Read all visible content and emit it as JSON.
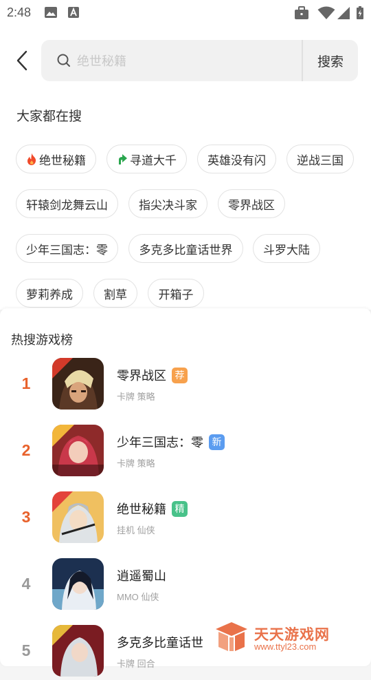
{
  "status_bar": {
    "time": "2:48"
  },
  "search": {
    "placeholder": "绝世秘籍",
    "button_label": "搜索"
  },
  "hot_search": {
    "title": "大家都在搜",
    "tags": [
      {
        "label": "绝世秘籍",
        "icon": "fire-icon"
      },
      {
        "label": "寻道大千",
        "icon": "trending-up-icon"
      },
      {
        "label": "英雄没有闪"
      },
      {
        "label": "逆战三国"
      },
      {
        "label": "轩辕剑龙舞云山"
      },
      {
        "label": "指尖决斗家"
      },
      {
        "label": "零界战区"
      },
      {
        "label": "少年三国志：零"
      },
      {
        "label": "多克多比童话世界"
      },
      {
        "label": "斗罗大陆"
      },
      {
        "label": "萝莉养成"
      },
      {
        "label": "割草"
      },
      {
        "label": "开箱子"
      }
    ]
  },
  "ranking": {
    "title": "热搜游戏榜",
    "items": [
      {
        "rank": "1",
        "name": "零界战区",
        "badge": "荐",
        "badge_color": "#f7a14d",
        "tags": "卡牌 策略",
        "rank_color": "#e8622c"
      },
      {
        "rank": "2",
        "name": "少年三国志：零",
        "badge": "新",
        "badge_color": "#5b9cf0",
        "tags": "卡牌 策略",
        "rank_color": "#e8622c"
      },
      {
        "rank": "3",
        "name": "绝世秘籍",
        "badge": "精",
        "badge_color": "#49c28a",
        "tags": "挂机 仙侠",
        "rank_color": "#e8622c"
      },
      {
        "rank": "4",
        "name": "逍遥蜀山",
        "tags": "MMO 仙侠",
        "rank_color": "#999999"
      },
      {
        "rank": "5",
        "name": "多克多比童话世",
        "tags": "卡牌 回合",
        "rank_color": "#999999"
      }
    ]
  },
  "watermark": {
    "brand": "天天游戏网",
    "url": "www.ttyl23.com"
  }
}
